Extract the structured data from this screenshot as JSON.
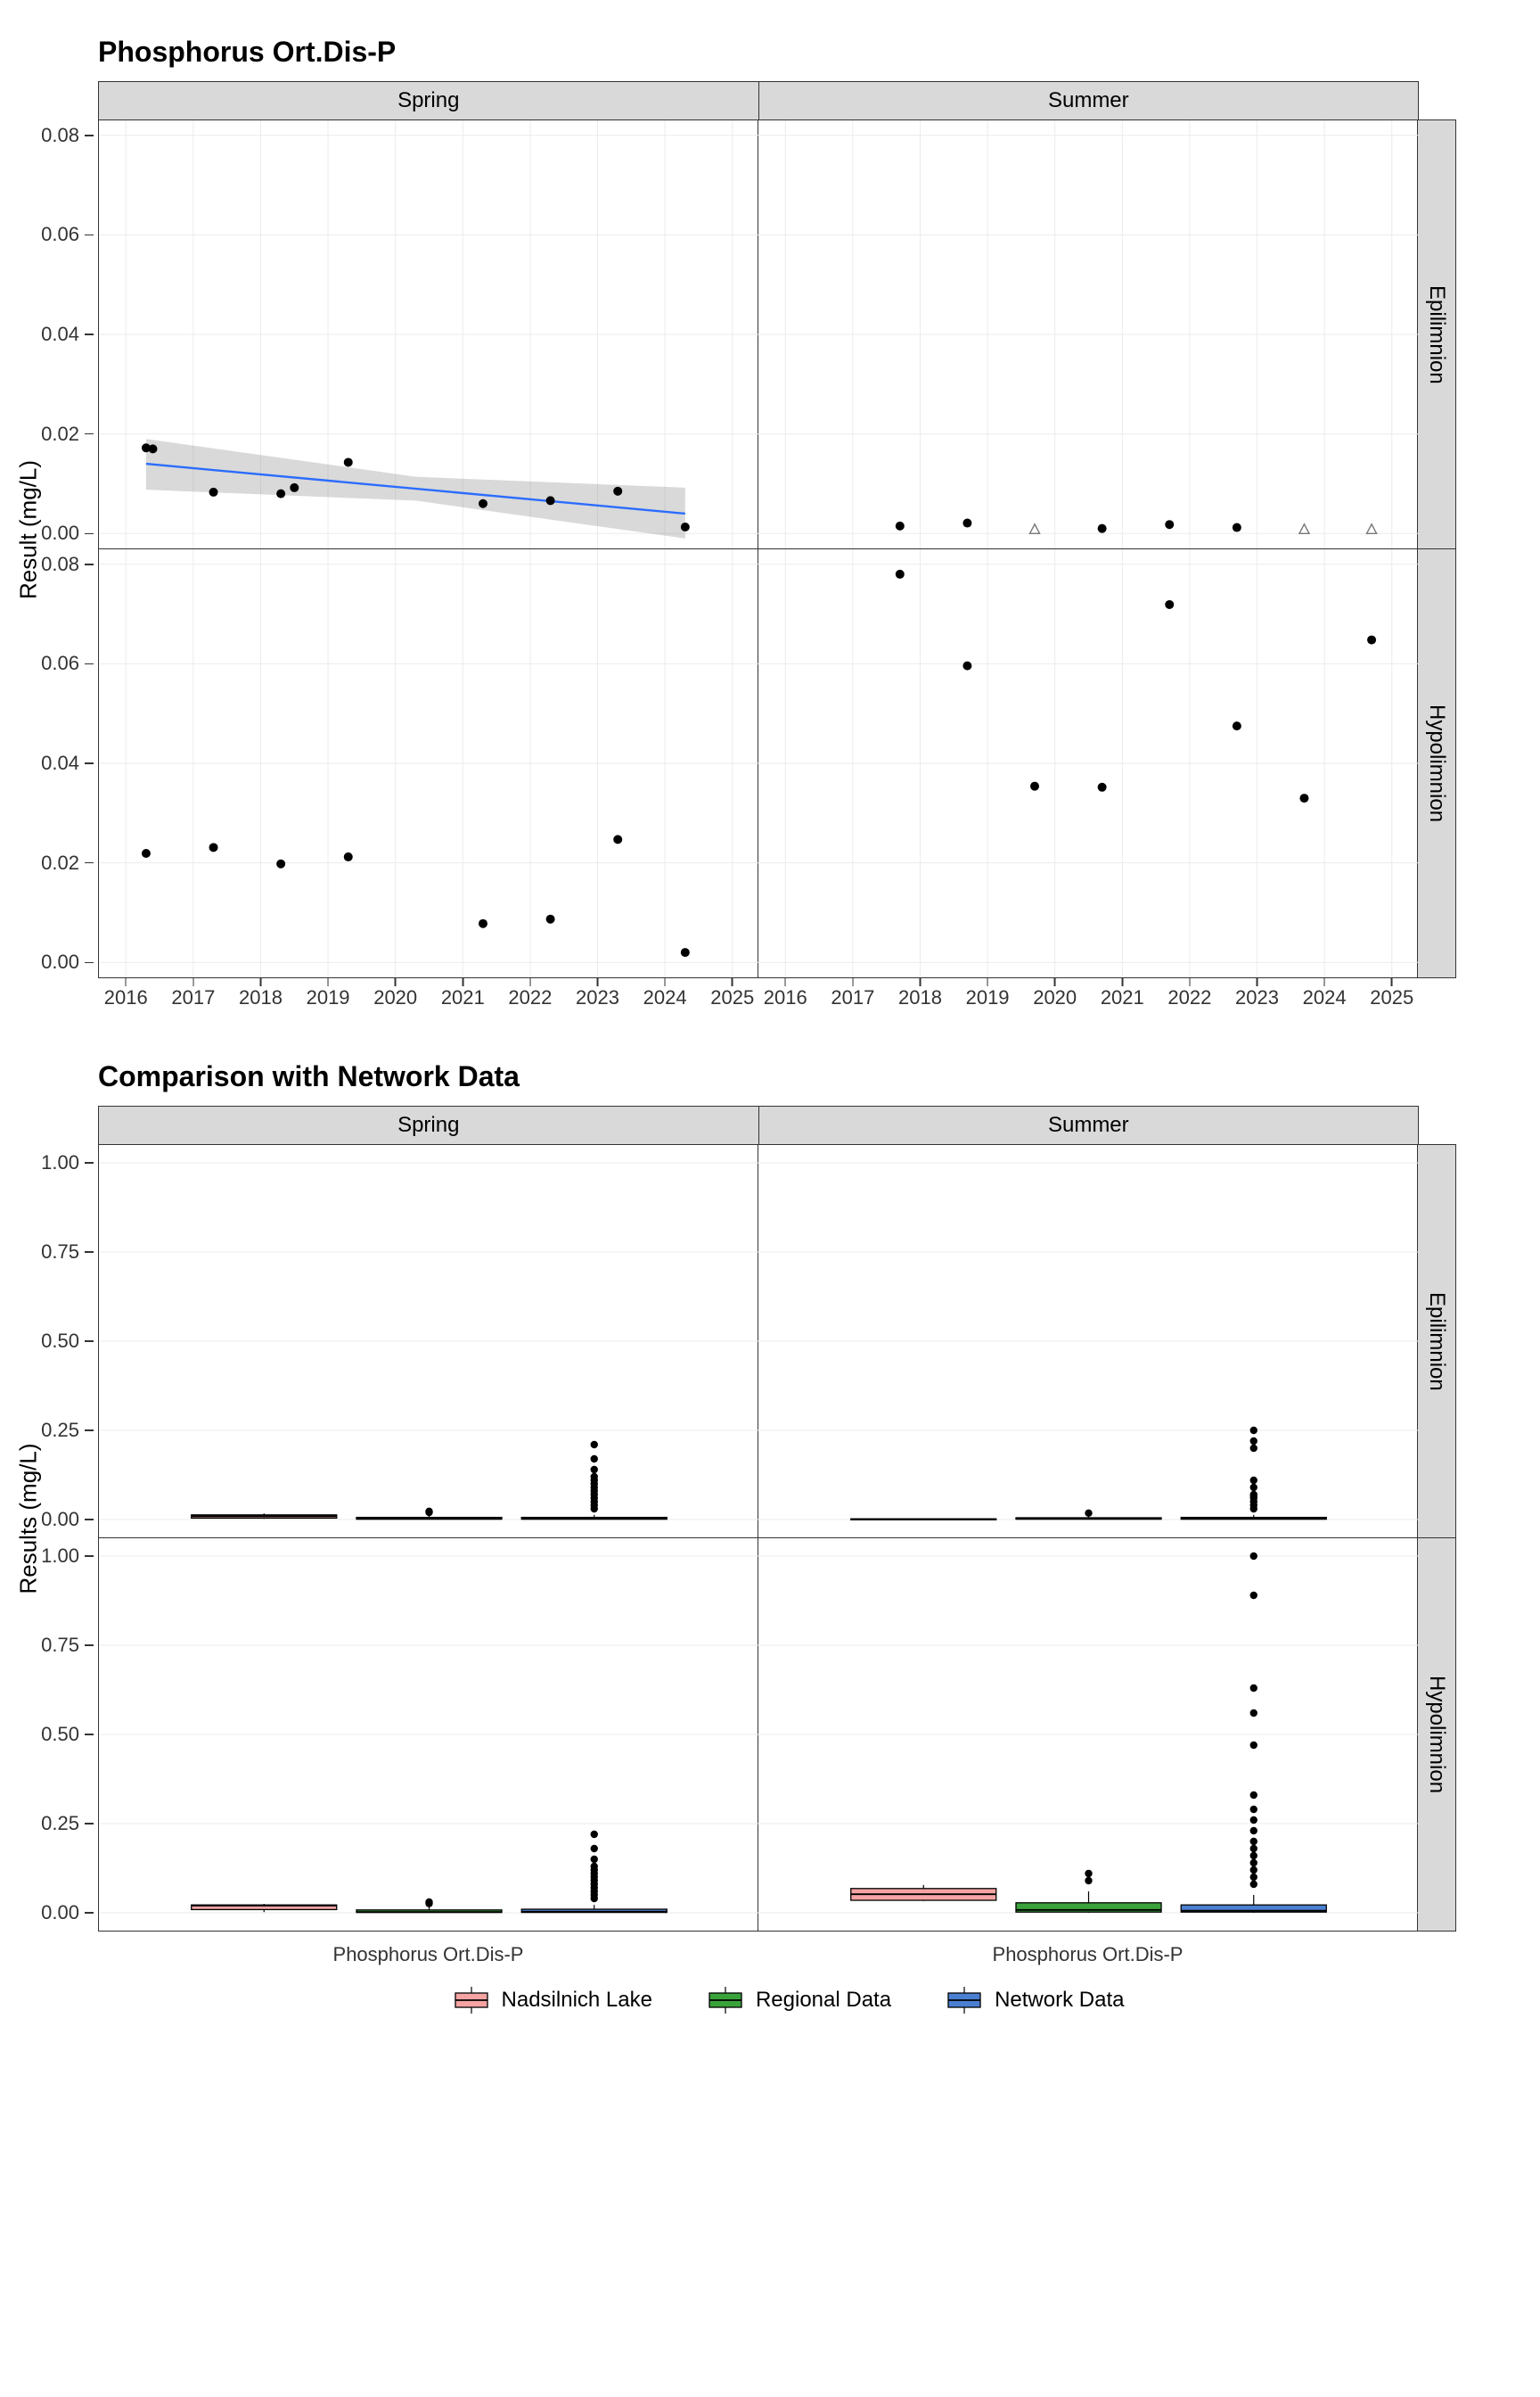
{
  "top": {
    "title": "Phosphorus Ort.Dis-P",
    "ylab": "Result (mg/L)",
    "col_facets": [
      "Spring",
      "Summer"
    ],
    "row_facets": [
      "Epilimnion",
      "Hypolimnion"
    ],
    "x_ticks": [
      2016,
      2017,
      2018,
      2019,
      2020,
      2021,
      2022,
      2023,
      2024,
      2025
    ],
    "y_ticks": [
      0.0,
      0.02,
      0.04,
      0.06,
      0.08
    ],
    "xlim": [
      2015.6,
      2025.4
    ],
    "ylim": [
      -0.003,
      0.083
    ]
  },
  "bottom": {
    "title": "Comparison with Network Data",
    "ylab": "Results (mg/L)",
    "col_facets": [
      "Spring",
      "Summer"
    ],
    "row_facets": [
      "Epilimnion",
      "Hypolimnion"
    ],
    "y_ticks": [
      0.0,
      0.25,
      0.5,
      0.75,
      1.0
    ],
    "ylim": [
      -0.05,
      1.05
    ],
    "x_category": "Phosphorus Ort.Dis-P"
  },
  "legend": {
    "items": [
      {
        "label": "Nadsilnich Lake",
        "fill": "#f5a3a3"
      },
      {
        "label": "Regional Data",
        "fill": "#3aa23a"
      },
      {
        "label": "Network Data",
        "fill": "#4a7fd1"
      }
    ]
  },
  "chart_data": [
    {
      "id": "top-spring-epi",
      "type": "scatter",
      "parent": "top",
      "col": "Spring",
      "row": "Epilimnion",
      "points": [
        {
          "x": 2016.3,
          "y": 0.0172
        },
        {
          "x": 2016.4,
          "y": 0.017
        },
        {
          "x": 2017.3,
          "y": 0.0083
        },
        {
          "x": 2018.3,
          "y": 0.008
        },
        {
          "x": 2018.5,
          "y": 0.0092
        },
        {
          "x": 2019.3,
          "y": 0.0143
        },
        {
          "x": 2021.3,
          "y": 0.006
        },
        {
          "x": 2022.3,
          "y": 0.0066
        },
        {
          "x": 2023.3,
          "y": 0.0085
        },
        {
          "x": 2024.3,
          "y": 0.0013
        }
      ],
      "trend": {
        "x0": 2016.3,
        "y0": 0.014,
        "x1": 2024.3,
        "y1": 0.004,
        "ribbon": [
          {
            "x": 2016.3,
            "lo": 0.0088,
            "hi": 0.019
          },
          {
            "x": 2020.3,
            "lo": 0.0066,
            "hi": 0.0114
          },
          {
            "x": 2024.3,
            "lo": -0.001,
            "hi": 0.0092
          }
        ]
      }
    },
    {
      "id": "top-summer-epi",
      "type": "scatter",
      "parent": "top",
      "col": "Summer",
      "row": "Epilimnion",
      "points": [
        {
          "x": 2017.7,
          "y": 0.0015
        },
        {
          "x": 2018.7,
          "y": 0.0021
        },
        {
          "x": 2019.7,
          "y": 0.0008,
          "open": true
        },
        {
          "x": 2020.7,
          "y": 0.001
        },
        {
          "x": 2021.7,
          "y": 0.0018
        },
        {
          "x": 2022.7,
          "y": 0.0012
        },
        {
          "x": 2023.7,
          "y": 0.0008,
          "open": true
        },
        {
          "x": 2024.7,
          "y": 0.0008,
          "open": true
        }
      ]
    },
    {
      "id": "top-spring-hypo",
      "type": "scatter",
      "parent": "top",
      "col": "Spring",
      "row": "Hypolimnion",
      "points": [
        {
          "x": 2016.3,
          "y": 0.0219
        },
        {
          "x": 2017.3,
          "y": 0.0231
        },
        {
          "x": 2018.3,
          "y": 0.0198
        },
        {
          "x": 2019.3,
          "y": 0.0212
        },
        {
          "x": 2021.3,
          "y": 0.0078
        },
        {
          "x": 2022.3,
          "y": 0.0087
        },
        {
          "x": 2023.3,
          "y": 0.0247
        },
        {
          "x": 2024.3,
          "y": 0.002
        }
      ]
    },
    {
      "id": "top-summer-hypo",
      "type": "scatter",
      "parent": "top",
      "col": "Summer",
      "row": "Hypolimnion",
      "points": [
        {
          "x": 2017.7,
          "y": 0.078
        },
        {
          "x": 2018.7,
          "y": 0.0596
        },
        {
          "x": 2019.7,
          "y": 0.0354
        },
        {
          "x": 2020.7,
          "y": 0.0352
        },
        {
          "x": 2021.7,
          "y": 0.0719
        },
        {
          "x": 2022.7,
          "y": 0.0475
        },
        {
          "x": 2023.7,
          "y": 0.033
        },
        {
          "x": 2024.7,
          "y": 0.0648
        }
      ]
    },
    {
      "id": "bot-spring-epi",
      "type": "box",
      "parent": "bottom",
      "col": "Spring",
      "row": "Epilimnion",
      "groups": [
        {
          "name": "Nadsilnich Lake",
          "fill": "#f5a3a3",
          "q1": 0.004,
          "med": 0.009,
          "q3": 0.013,
          "lo": 0.002,
          "hi": 0.017,
          "out": []
        },
        {
          "name": "Regional Data",
          "fill": "#3aa23a",
          "q1": 0.001,
          "med": 0.002,
          "q3": 0.006,
          "lo": 0.0,
          "hi": 0.012,
          "out": [
            0.02,
            0.023
          ]
        },
        {
          "name": "Network Data",
          "fill": "#4a7fd1",
          "q1": 0.001,
          "med": 0.002,
          "q3": 0.006,
          "lo": 0.0,
          "hi": 0.013,
          "out": [
            0.03,
            0.04,
            0.05,
            0.06,
            0.07,
            0.08,
            0.09,
            0.1,
            0.11,
            0.12,
            0.14,
            0.17,
            0.21
          ]
        }
      ]
    },
    {
      "id": "bot-summer-epi",
      "type": "box",
      "parent": "bottom",
      "col": "Summer",
      "row": "Epilimnion",
      "groups": [
        {
          "name": "Nadsilnich Lake",
          "fill": "#f5a3a3",
          "q1": 0.001,
          "med": 0.0012,
          "q3": 0.0018,
          "lo": 0.0008,
          "hi": 0.0022,
          "out": []
        },
        {
          "name": "Regional Data",
          "fill": "#3aa23a",
          "q1": 0.001,
          "med": 0.002,
          "q3": 0.005,
          "lo": 0.0,
          "hi": 0.01,
          "out": [
            0.018
          ]
        },
        {
          "name": "Network Data",
          "fill": "#4a7fd1",
          "q1": 0.001,
          "med": 0.002,
          "q3": 0.006,
          "lo": 0.0,
          "hi": 0.013,
          "out": [
            0.03,
            0.04,
            0.05,
            0.06,
            0.065,
            0.07,
            0.09,
            0.11,
            0.2,
            0.22,
            0.25
          ]
        }
      ]
    },
    {
      "id": "bot-spring-hypo",
      "type": "box",
      "parent": "bottom",
      "col": "Spring",
      "row": "Hypolimnion",
      "groups": [
        {
          "name": "Nadsilnich Lake",
          "fill": "#f5a3a3",
          "q1": 0.009,
          "med": 0.02,
          "q3": 0.022,
          "lo": 0.002,
          "hi": 0.025,
          "out": []
        },
        {
          "name": "Regional Data",
          "fill": "#3aa23a",
          "q1": 0.001,
          "med": 0.002,
          "q3": 0.008,
          "lo": 0.0,
          "hi": 0.017,
          "out": [
            0.026,
            0.03
          ]
        },
        {
          "name": "Network Data",
          "fill": "#4a7fd1",
          "q1": 0.001,
          "med": 0.003,
          "q3": 0.01,
          "lo": 0.0,
          "hi": 0.022,
          "out": [
            0.04,
            0.05,
            0.06,
            0.07,
            0.08,
            0.09,
            0.1,
            0.11,
            0.12,
            0.13,
            0.15,
            0.18,
            0.22
          ]
        }
      ]
    },
    {
      "id": "bot-summer-hypo",
      "type": "box",
      "parent": "bottom",
      "col": "Summer",
      "row": "Hypolimnion",
      "groups": [
        {
          "name": "Nadsilnich Lake",
          "fill": "#f5a3a3",
          "q1": 0.035,
          "med": 0.052,
          "q3": 0.068,
          "lo": 0.033,
          "hi": 0.078,
          "out": []
        },
        {
          "name": "Regional Data",
          "fill": "#3aa23a",
          "q1": 0.002,
          "med": 0.008,
          "q3": 0.028,
          "lo": 0.0,
          "hi": 0.06,
          "out": [
            0.09,
            0.11
          ]
        },
        {
          "name": "Network Data",
          "fill": "#4a7fd1",
          "q1": 0.002,
          "med": 0.006,
          "q3": 0.022,
          "lo": 0.0,
          "hi": 0.05,
          "out": [
            0.08,
            0.1,
            0.12,
            0.14,
            0.16,
            0.18,
            0.2,
            0.23,
            0.26,
            0.29,
            0.33,
            0.47,
            0.56,
            0.63,
            0.89,
            1.0
          ]
        }
      ]
    }
  ]
}
